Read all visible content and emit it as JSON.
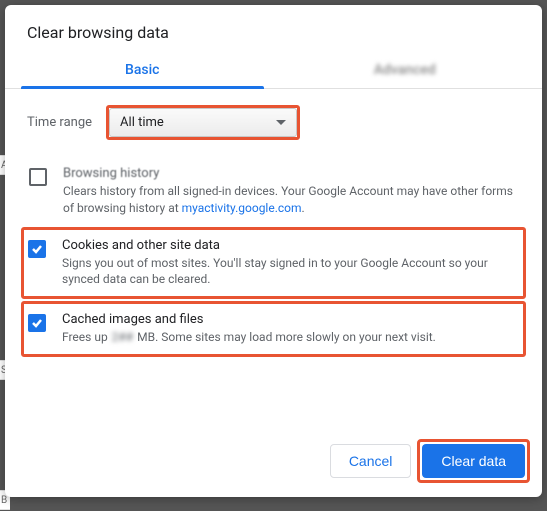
{
  "dialog": {
    "title": "Clear browsing data",
    "tabs": {
      "basic": "Basic",
      "advanced": "Advanced"
    },
    "time_range": {
      "label": "Time range",
      "value": "All time"
    },
    "items": [
      {
        "checked": false,
        "title": "Browsing history",
        "desc_pre": "Clears history from all signed-in devices. Your Google Account may have other forms of browsing history at ",
        "desc_link": "myactivity.google.com",
        "desc_post": "."
      },
      {
        "checked": true,
        "title": "Cookies and other site data",
        "desc": "Signs you out of most sites. You'll stay signed in to your Google Account so your synced data can be cleared."
      },
      {
        "checked": true,
        "title": "Cached images and files",
        "desc_pre": "Frees up ",
        "desc_num": "2##",
        "desc_post": " MB. Some sites may load more slowly on your next visit."
      }
    ],
    "buttons": {
      "cancel": "Cancel",
      "clear": "Clear data"
    }
  }
}
